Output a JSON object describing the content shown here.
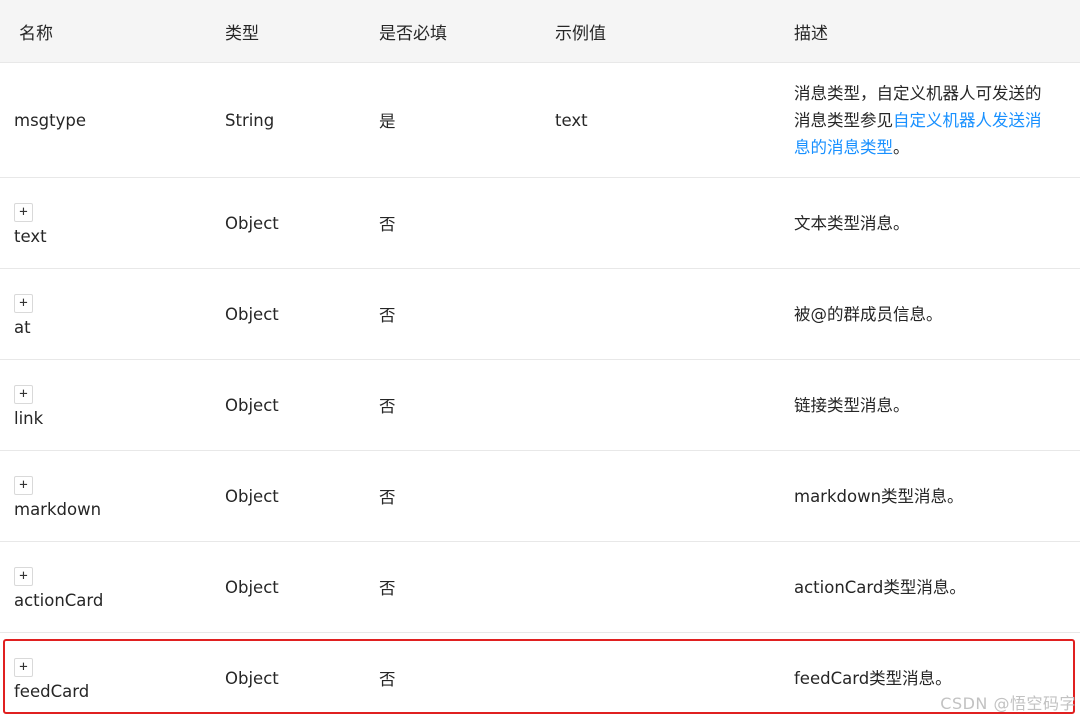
{
  "table": {
    "headers": {
      "name": "名称",
      "type": "类型",
      "required": "是否必填",
      "example": "示例值",
      "description": "描述"
    },
    "expand_symbol": "+",
    "rows": [
      {
        "name": "msgtype",
        "type": "String",
        "required": "是",
        "example": "text",
        "description_prefix": "消息类型，自定义机器人可发送的消息类型参见",
        "description_link": "自定义机器人发送消息的消息类型",
        "description_suffix": "。"
      },
      {
        "name": "text",
        "type": "Object",
        "required": "否",
        "example": "",
        "description": "文本类型消息。"
      },
      {
        "name": "at",
        "type": "Object",
        "required": "否",
        "example": "",
        "description": "被@的群成员信息。"
      },
      {
        "name": "link",
        "type": "Object",
        "required": "否",
        "example": "",
        "description": "链接类型消息。"
      },
      {
        "name": "markdown",
        "type": "Object",
        "required": "否",
        "example": "",
        "description": "markdown类型消息。"
      },
      {
        "name": "actionCard",
        "type": "Object",
        "required": "否",
        "example": "",
        "description": "actionCard类型消息。"
      },
      {
        "name": "feedCard",
        "type": "Object",
        "required": "否",
        "example": "",
        "description": "feedCard类型消息。"
      }
    ]
  },
  "watermark": "CSDN @悟空码字",
  "colors": {
    "header_bg": "#f5f5f5",
    "link": "#1890ff",
    "highlight": "#e02020",
    "border": "#e8e8e8"
  }
}
